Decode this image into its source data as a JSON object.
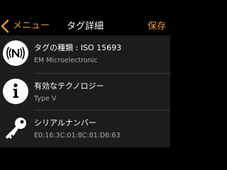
{
  "navbar": {
    "back_label": "メニュー",
    "title": "タグ詳細",
    "save_label": "保存"
  },
  "rows": [
    {
      "title": "タグの種類 : ISO 15693",
      "subtitle": "EM Microelectronic",
      "icon": "nfc-signal-icon"
    },
    {
      "title": "有効なテクノロジー",
      "subtitle": "Type V",
      "icon": "info-icon"
    },
    {
      "title": "シリアルナンバー",
      "subtitle": "E0:16:3C:01:8C:81:D6:63",
      "icon": "key-icon"
    }
  ],
  "colors": {
    "accent": "#e39a3b",
    "background": "#000000",
    "panel": "#1c1c1e",
    "text_primary": "#ffffff",
    "text_secondary": "#a9a9ae"
  }
}
